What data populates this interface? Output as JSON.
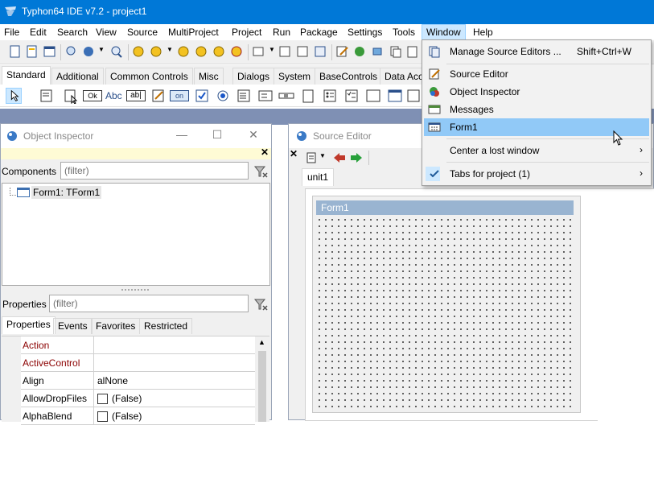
{
  "window": {
    "title": "Typhon64 IDE v7.2 - project1"
  },
  "menubar": {
    "items": [
      "File",
      "Edit",
      "Search",
      "View",
      "Source",
      "MultiProject",
      "Project",
      "Run",
      "Package",
      "Settings",
      "Tools",
      "Window",
      "Help"
    ],
    "active": "Window"
  },
  "palette": {
    "tabs": [
      "Standard",
      "Additional",
      "Common Controls",
      "Misc",
      "Dialogs",
      "System",
      "BaseControls",
      "Data Acc"
    ],
    "active_tab": "Standard",
    "component_labels": {
      "button": "Ok",
      "label": "Abc",
      "edit": "ab|",
      "toggle": "on"
    }
  },
  "object_inspector": {
    "title": "Object Inspector",
    "components_label": "Components",
    "components_filter_placeholder": "(filter)",
    "tree_node": "Form1: TForm1",
    "properties_label": "Properties",
    "properties_filter_placeholder": "(filter)",
    "tabs": [
      "Properties",
      "Events",
      "Favorites",
      "Restricted"
    ],
    "properties": [
      {
        "name": "Action",
        "value": "",
        "highlight": true
      },
      {
        "name": "ActiveControl",
        "value": "",
        "highlight": true
      },
      {
        "name": "Align",
        "value": "alNone",
        "highlight": false
      },
      {
        "name": "AllowDropFiles",
        "value": "(False)",
        "highlight": false,
        "checkbox": true
      },
      {
        "name": "AlphaBlend",
        "value": "(False)",
        "highlight": false,
        "checkbox": true
      }
    ]
  },
  "source_editor": {
    "title": "Source Editor",
    "tab": "unit1",
    "form_caption": "Form1"
  },
  "window_menu": {
    "items": [
      {
        "label": "Manage Source Editors ...",
        "shortcut": "Shift+Ctrl+W",
        "icon": "source-editors-icon"
      },
      {
        "label": "Source Editor",
        "icon": "source-editor-icon"
      },
      {
        "label": "Object Inspector",
        "icon": "object-inspector-icon"
      },
      {
        "label": "Messages",
        "icon": "messages-icon"
      },
      {
        "label": "Form1",
        "icon": "form-icon",
        "hover": true
      },
      {
        "label": "Center a lost window",
        "submenu": true
      },
      {
        "label": "Tabs for project (1)",
        "submenu": true,
        "checked": true
      }
    ]
  },
  "colors": {
    "titlebar": "#0078d7",
    "menu_hover": "#91c9f7",
    "property_highlight": "#8b0000"
  }
}
